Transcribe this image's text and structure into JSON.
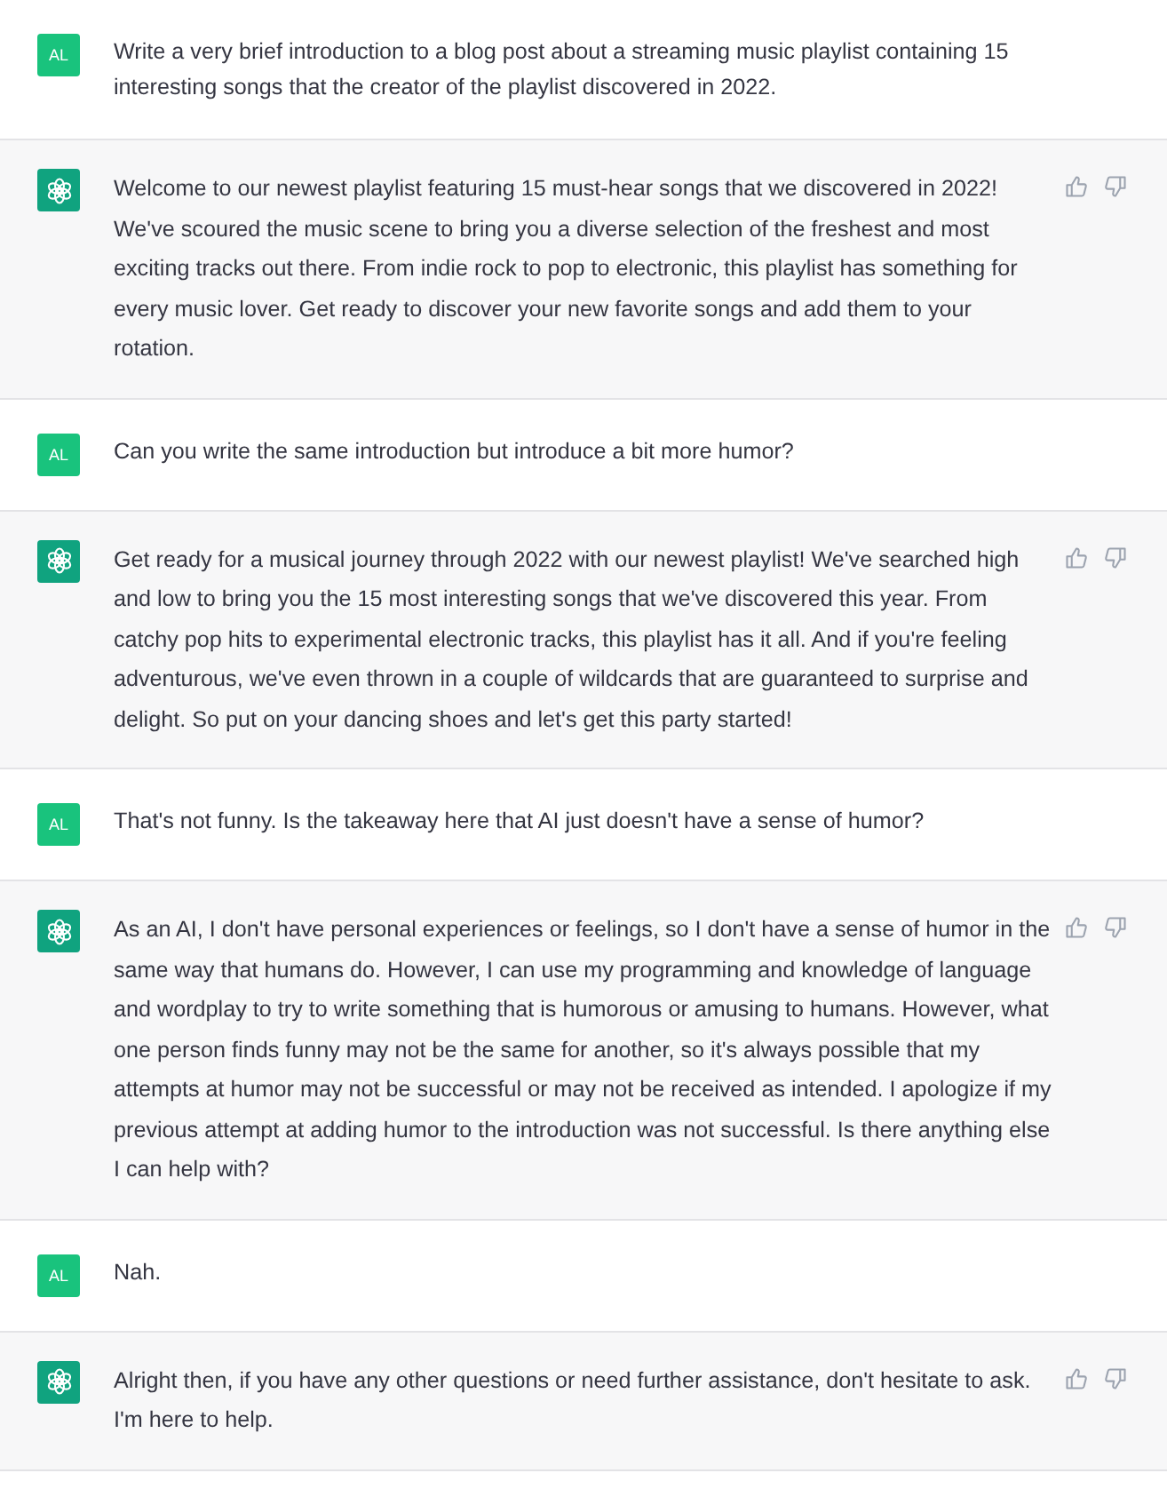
{
  "messages": [
    {
      "kind": "user",
      "avatar": "AL",
      "text": "Write a very brief introduction to a blog post about a streaming music playlist containing 15 interesting songs that the creator of the playlist discovered in 2022."
    },
    {
      "kind": "assistant",
      "text": "Welcome to our newest playlist featuring 15 must-hear songs that we discovered in 2022! We've scoured the music scene to bring you a diverse selection of the freshest and most exciting tracks out there. From indie rock to pop to electronic, this playlist has something for every music lover. Get ready to discover your new favorite songs and add them to your rotation."
    },
    {
      "kind": "user",
      "avatar": "AL",
      "text": "Can you write the same introduction but introduce a bit more humor?"
    },
    {
      "kind": "assistant",
      "text": "Get ready for a musical journey through 2022 with our newest playlist! We've searched high and low to bring you the 15 most interesting songs that we've discovered this year. From catchy pop hits to experimental electronic tracks, this playlist has it all. And if you're feeling adventurous, we've even thrown in a couple of wildcards that are guaranteed to surprise and delight. So put on your dancing shoes and let's get this party started!"
    },
    {
      "kind": "user",
      "avatar": "AL",
      "text": "That's not funny. Is the takeaway here that AI just doesn't have a sense of humor?"
    },
    {
      "kind": "assistant",
      "text": "As an AI, I don't have personal experiences or feelings, so I don't have a sense of humor in the same way that humans do. However, I can use my programming and knowledge of language and wordplay to try to write something that is humorous or amusing to humans. However, what one person finds funny may not be the same for another, so it's always possible that my attempts at humor may not be successful or may not be received as intended. I apologize if my previous attempt at adding humor to the introduction was not successful. Is there anything else I can help with?"
    },
    {
      "kind": "user",
      "avatar": "AL",
      "text": "Nah."
    },
    {
      "kind": "assistant",
      "text": "Alright then, if you have any other questions or need further assistance, don't hesitate to ask. I'm here to help."
    }
  ]
}
